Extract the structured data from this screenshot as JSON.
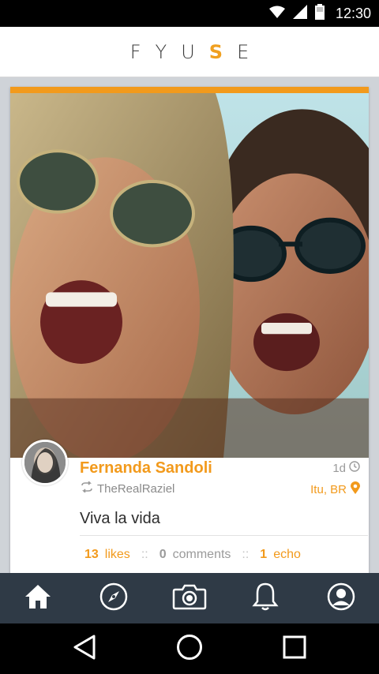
{
  "status_bar": {
    "time": "12:30",
    "icons": [
      "wifi-icon",
      "cell-signal-icon",
      "battery-icon"
    ]
  },
  "header": {
    "logo_pre": "FYU",
    "logo_accent": "S",
    "logo_post": "E"
  },
  "post": {
    "author_name": "Fernanda Sandoli",
    "echoed_by": "TheRealRaziel",
    "time_ago": "1d",
    "location": "Itu, BR",
    "caption": "Viva la vida",
    "likes_count": "13",
    "likes_label": "likes",
    "comments_count": "0",
    "comments_label": "comments",
    "echo_count": "1",
    "echo_label": "echo",
    "separator": "::"
  },
  "bottom_nav": {
    "items": [
      "home-icon",
      "explore-compass-icon",
      "camera-icon",
      "notifications-bell-icon",
      "profile-icon"
    ],
    "active": "home-icon"
  },
  "colors": {
    "accent": "#f29a1c",
    "nav_bg": "#2f3a46",
    "page_bg": "#cfd3d8"
  }
}
